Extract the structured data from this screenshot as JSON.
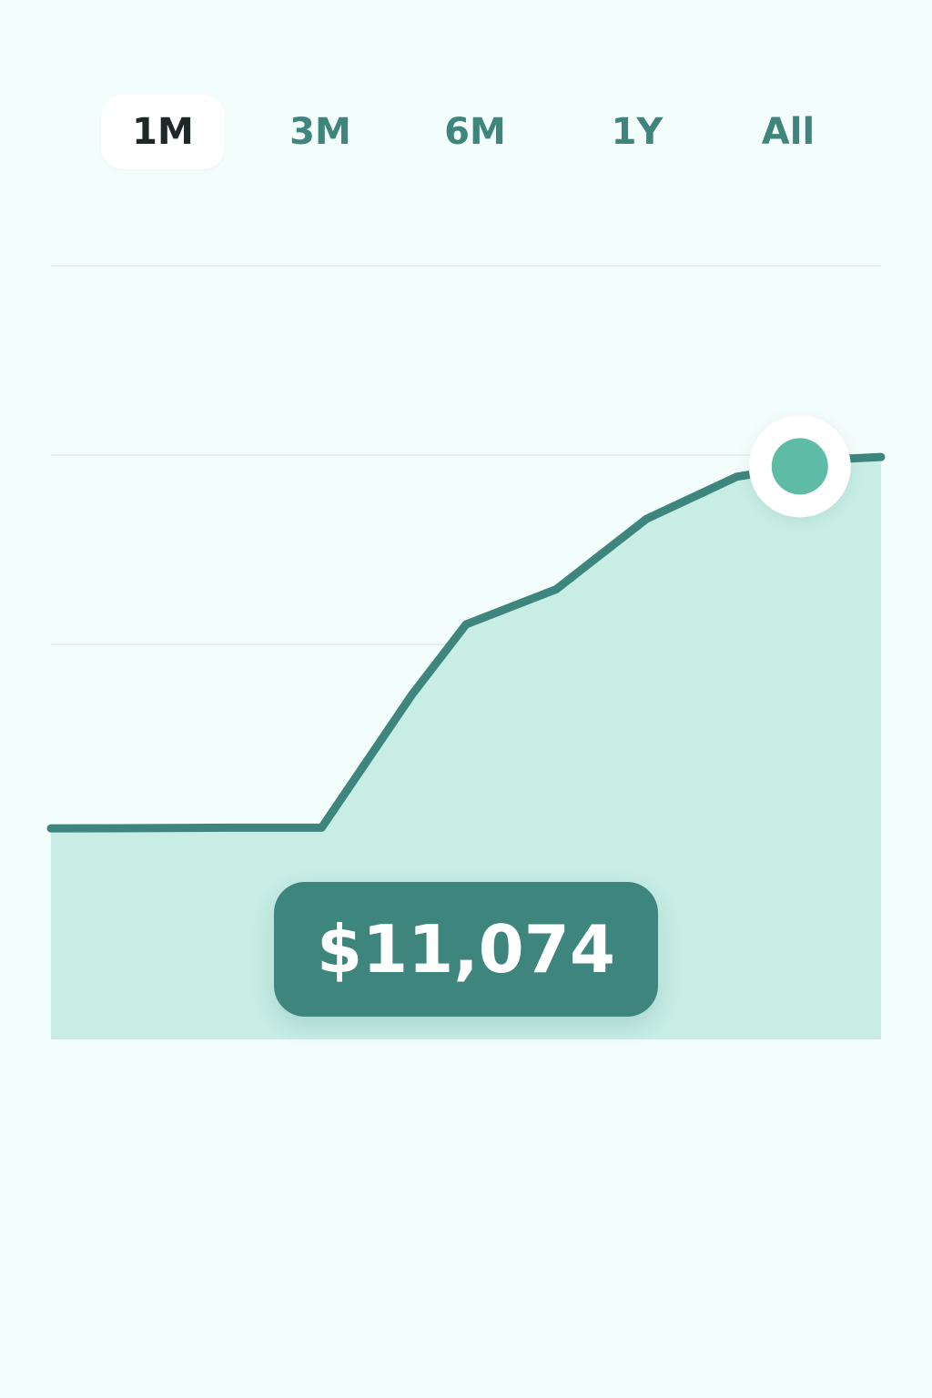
{
  "tabs": [
    {
      "label": "1M",
      "active": true
    },
    {
      "label": "3M",
      "active": false
    },
    {
      "label": "6M",
      "active": false
    },
    {
      "label": "1Y",
      "active": false
    },
    {
      "label": "All",
      "active": false
    }
  ],
  "colors": {
    "background": "#f3fdfc",
    "line": "#3e867d",
    "area": "#c7ede5",
    "gridline": "#dfecea",
    "marker": "#5dbba6",
    "badge": "#3e867d",
    "tab_active_text": "#1e2826",
    "tab_text": "#3e867d"
  },
  "chart_data": {
    "type": "area",
    "x": [
      0,
      10,
      20,
      30,
      40,
      46,
      56,
      66,
      76,
      83,
      87,
      92
    ],
    "values": [
      8500,
      8502,
      8505,
      8505,
      9450,
      9950,
      10200,
      10700,
      11000,
      11074,
      11125,
      11140
    ],
    "ylim": [
      7000,
      12500
    ],
    "xlim": [
      0,
      92
    ],
    "grid": true,
    "highlight_index": 9,
    "highlight_label": "$11,074"
  }
}
